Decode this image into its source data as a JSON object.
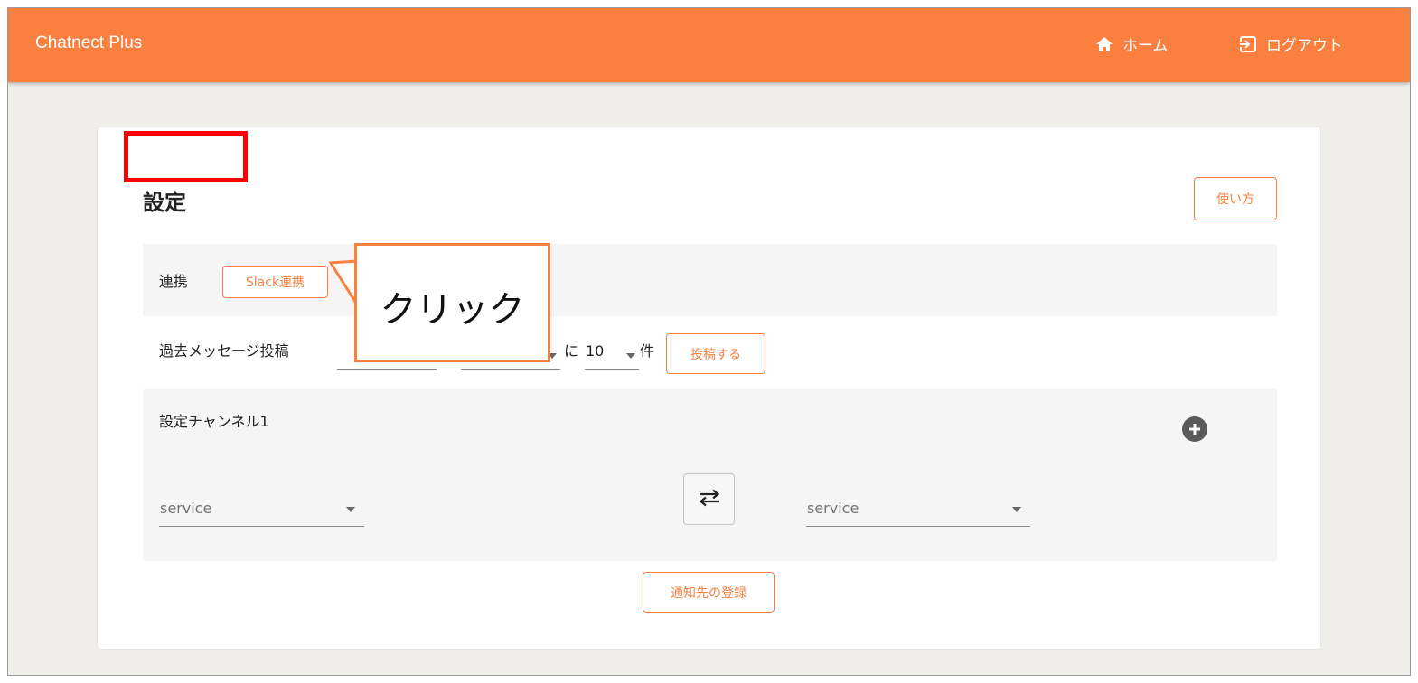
{
  "header": {
    "app_title": "Chatnect Plus",
    "home_label": "ホーム",
    "logout_label": "ログアウト"
  },
  "settings": {
    "title": "設定",
    "help_button": "使い方",
    "link_row": {
      "label": "連携",
      "slack_button": "Slack連携"
    },
    "post_row": {
      "label": "過去メッセージ投稿",
      "ni": "に",
      "count_value": "10",
      "ken": "件",
      "post_button": "投稿する"
    },
    "channel": {
      "title": "設定チャンネル1",
      "left_service_placeholder": "service",
      "right_service_placeholder": "service"
    },
    "register_button": "通知先の登録"
  },
  "annotation": {
    "callout_text": "クリック"
  },
  "colors": {
    "accent": "#fb8040",
    "highlight": "#ff0000"
  },
  "icons": {
    "home": "home-icon",
    "logout": "logout-icon",
    "add": "add-circle-icon",
    "swap": "swap-horiz-icon",
    "dropdown": "arrow-drop-down-icon"
  }
}
